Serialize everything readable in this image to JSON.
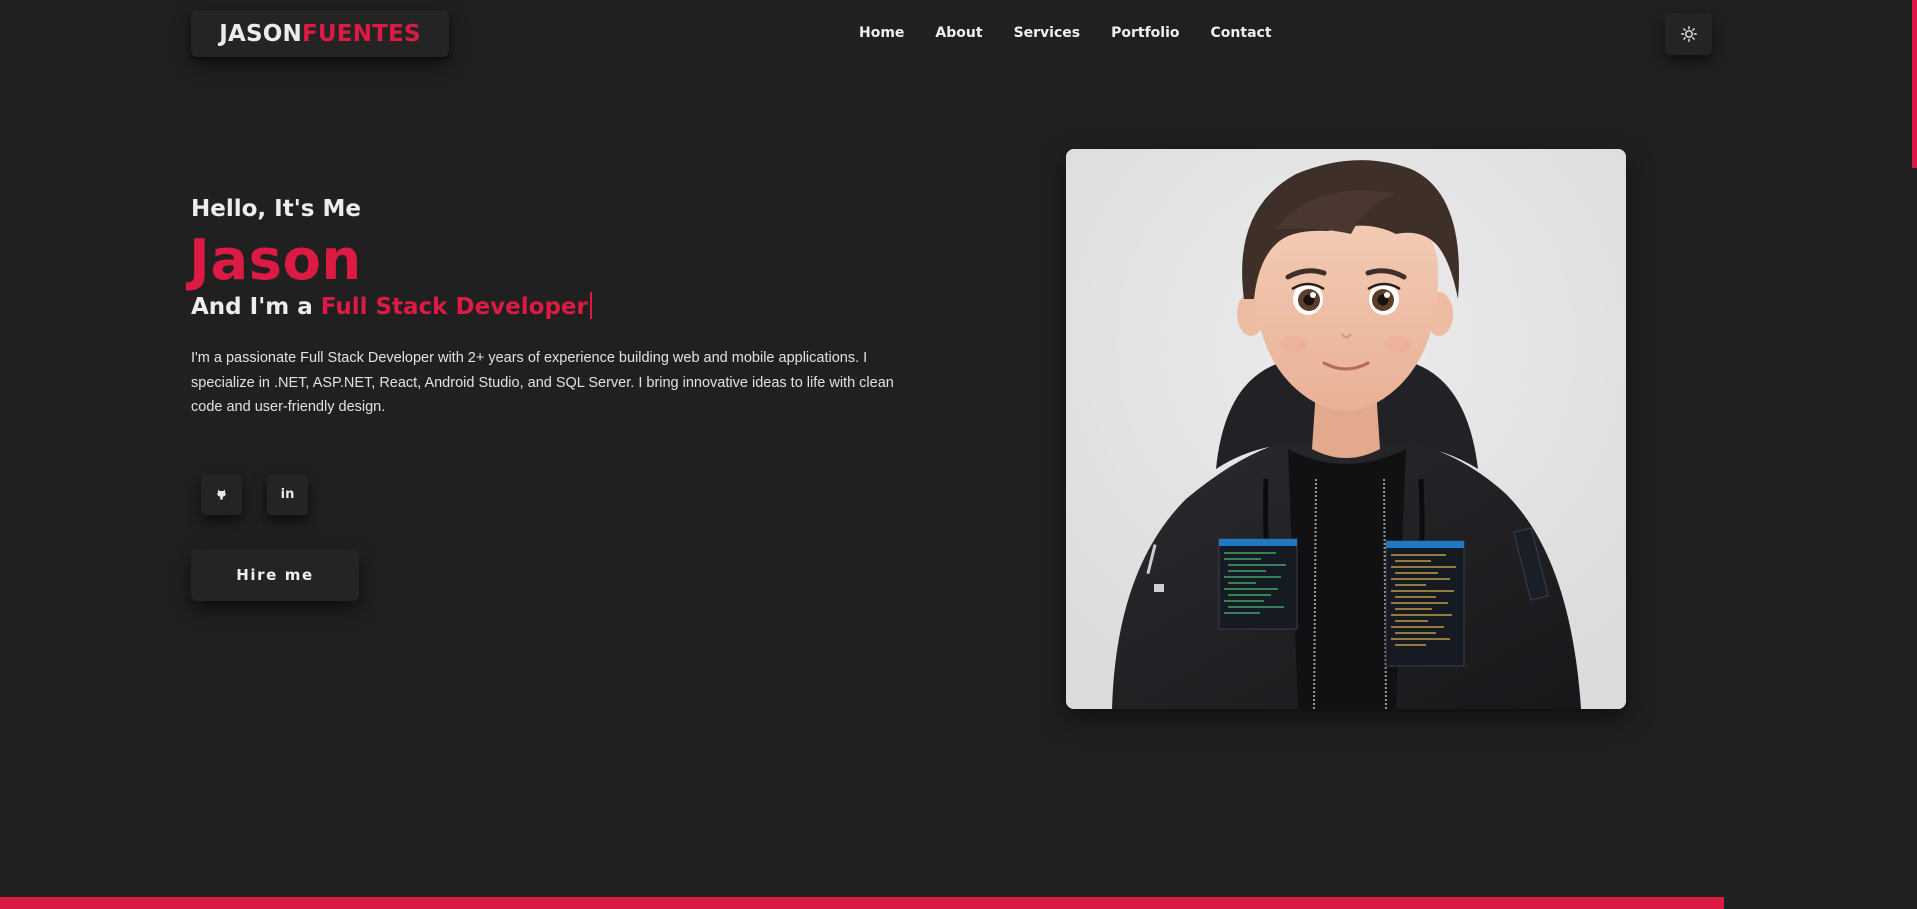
{
  "header": {
    "logo_first": "JASON",
    "logo_last": "FUENTES",
    "nav": [
      {
        "label": "Home"
      },
      {
        "label": "About"
      },
      {
        "label": "Services"
      },
      {
        "label": "Portfolio"
      },
      {
        "label": "Contact"
      }
    ],
    "theme_toggle_icon": "sun-icon"
  },
  "hero": {
    "greeting": "Hello, It's Me",
    "name": "Jason",
    "role_prefix": "And I'm a ",
    "role_highlight": "Full Stack Developer",
    "bio": "I'm a passionate Full Stack Developer with 2+ years of experience building web and mobile applications. I specialize in .NET, ASP.NET, React, Android Studio, and SQL Server. I bring innovative ideas to life with clean code and user-friendly design.",
    "social": [
      {
        "name": "github",
        "icon": "github-icon"
      },
      {
        "name": "linkedin",
        "icon": "linkedin-icon",
        "glyph": "in"
      }
    ],
    "cta_label": "Hire me",
    "portrait_subject": "3D cartoon avatar of a young man in a black hoodie"
  },
  "colors": {
    "background": "#202021",
    "surface": "#242425",
    "accent": "#dc1a44",
    "text": "#ededed"
  }
}
